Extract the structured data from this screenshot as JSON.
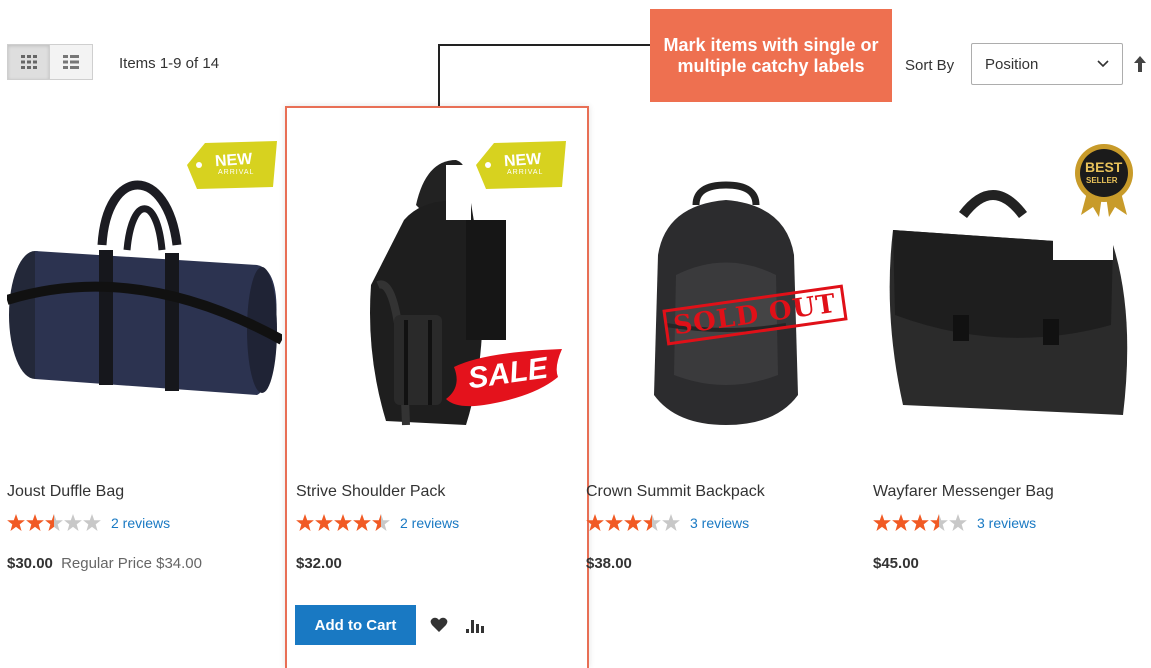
{
  "toolbar": {
    "items_count": "Items 1-9 of 14",
    "sort_label": "Sort By",
    "sort_value": "Position",
    "grid_icon": "grid-icon",
    "list_icon": "list-icon",
    "sort_direction_icon": "arrow-up-icon"
  },
  "callout": {
    "text": "Mark items with single or multiple catchy labels"
  },
  "colors": {
    "accent": "#ee7050",
    "link": "#1979c3",
    "star": "#f15a24",
    "star_empty": "#c8c8c8",
    "sold_out": "#e01018"
  },
  "products": [
    {
      "name": "Joust Duffle Bag",
      "rating": 2.5,
      "reviews": "2 reviews",
      "price": "$30.00",
      "regular_label": "Regular Price $34.00",
      "label": "NEW ARRIVAL"
    },
    {
      "name": "Strive Shoulder Pack",
      "rating": 4.5,
      "reviews": "2 reviews",
      "price": "$32.00",
      "labels": [
        "NEW ARRIVAL",
        "SALE"
      ]
    },
    {
      "name": "Crown Summit Backpack",
      "rating": 3.5,
      "reviews": "3 reviews",
      "price": "$38.00",
      "label": "SOLD OUT"
    },
    {
      "name": "Wayfarer Messenger Bag",
      "rating": 3.5,
      "reviews": "3 reviews",
      "price": "$45.00",
      "label": "BEST SELLER"
    }
  ],
  "badges": {
    "new_top": "NEW",
    "new_bottom": "ARRIVAL",
    "sale": "SALE",
    "sold_out": "SOLD OUT",
    "best": "BEST",
    "seller": "SELLER"
  },
  "actions": {
    "add_to_cart": "Add to Cart",
    "wishlist_icon": "heart-icon",
    "compare_icon": "bar-chart-icon"
  }
}
